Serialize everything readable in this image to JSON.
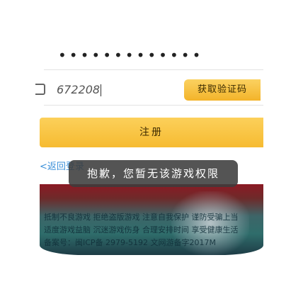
{
  "form": {
    "password_mask": "•••••••••••••",
    "code_value": "672208",
    "get_code_label": "获取验证码",
    "register_label": "注册",
    "back_link": "<返回登录"
  },
  "banner": {
    "line1": "抵制不良游戏 拒绝盗版游戏 注意自我保护 谨防受骗上当",
    "line2": "适度游戏益脑 沉迷游戏伤身 合理安排时间 享受健康生活",
    "line3": "备案号：闽ICP备 2979-5192 文网游备字2017M"
  },
  "toast": {
    "message": "抱歉，您暂无该游戏权限"
  },
  "colors": {
    "accent": "#f6bb31",
    "link": "#3a8fd9",
    "toast_bg": "#3c3c3c"
  }
}
